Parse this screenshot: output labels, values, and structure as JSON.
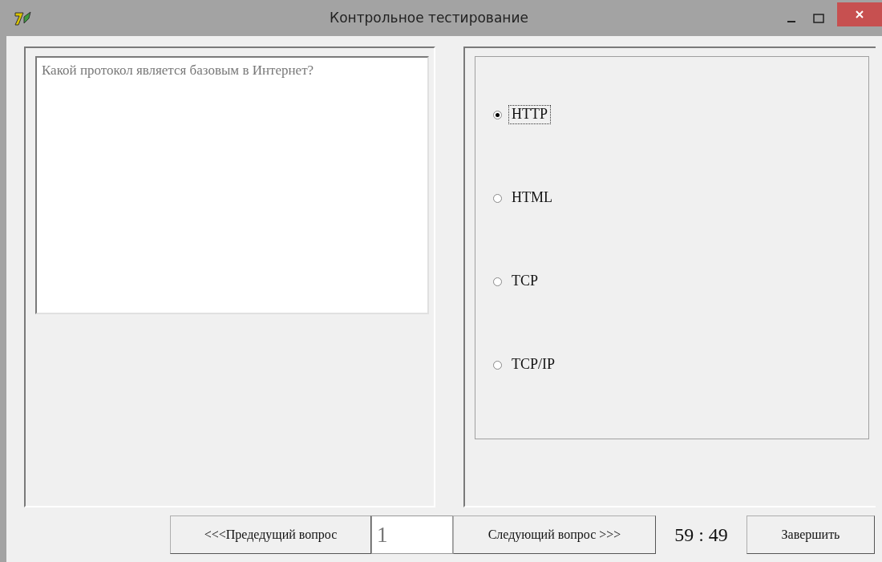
{
  "window": {
    "title": "Контрольное тестирование"
  },
  "question": {
    "text": "Какой протокол является базовым в Интернет?"
  },
  "answers": [
    {
      "label": "HTTP",
      "selected": true
    },
    {
      "label": "HTML",
      "selected": false
    },
    {
      "label": "TCP",
      "selected": false
    },
    {
      "label": "TCP/IP",
      "selected": false
    }
  ],
  "navigation": {
    "previous": "<<<Предедущий вопрос",
    "number": "1",
    "next": "Следующий вопрос >>>",
    "timer": "59 : 49",
    "finish": "Завершить"
  }
}
